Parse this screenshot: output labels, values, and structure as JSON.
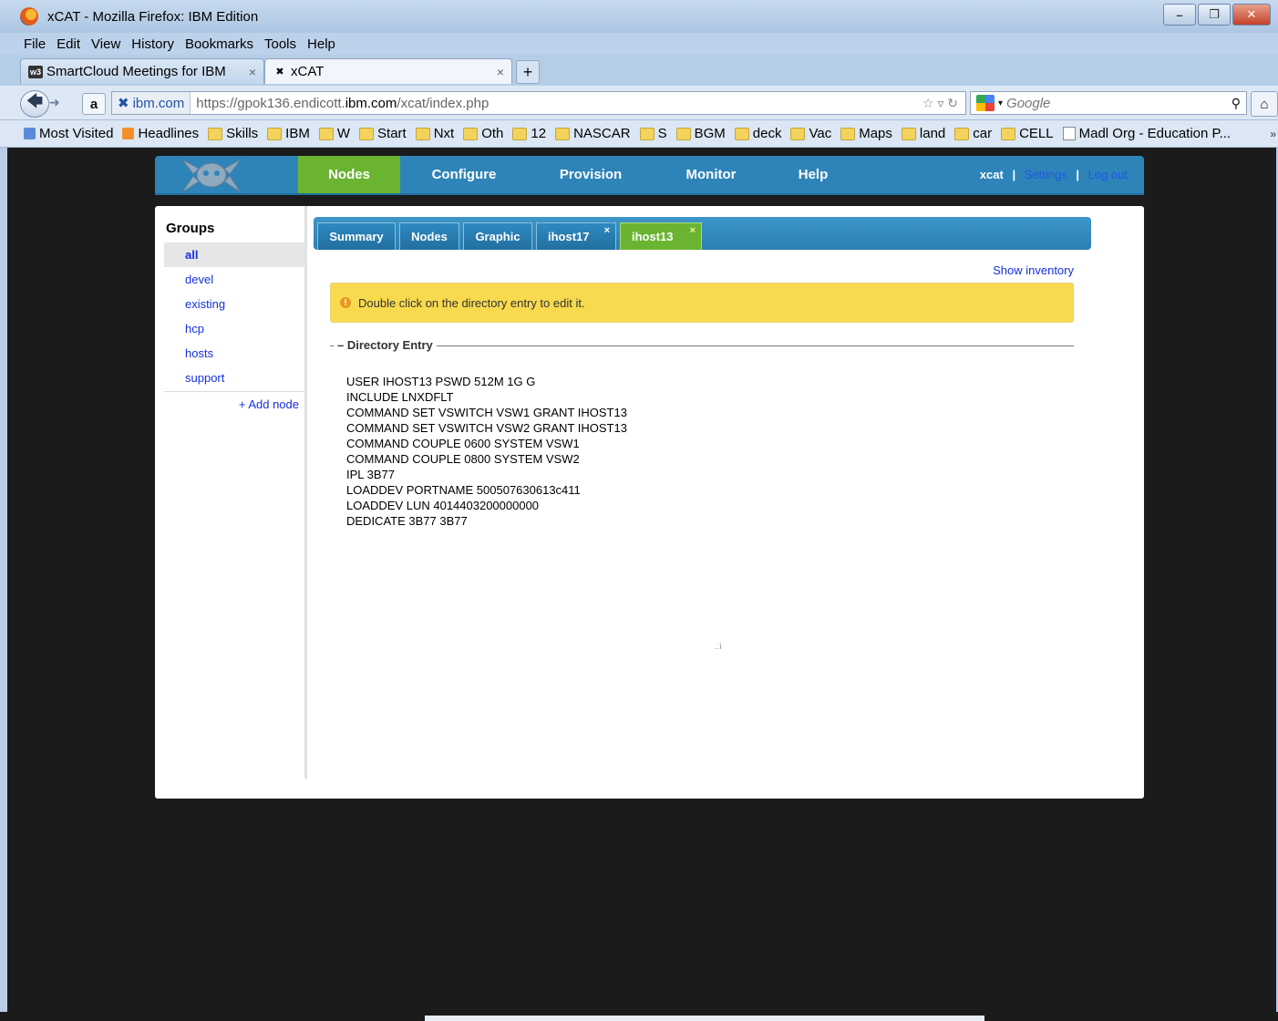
{
  "window": {
    "title": "xCAT - Mozilla Firefox: IBM Edition",
    "buttons": {
      "minimize": "–",
      "restore": "❐",
      "close": "✕"
    }
  },
  "menu": [
    "File",
    "Edit",
    "View",
    "History",
    "Bookmarks",
    "Tools",
    "Help"
  ],
  "browser_tabs": [
    {
      "label": "SmartCloud Meetings for IBM",
      "favicon": "w3"
    },
    {
      "label": "xCAT",
      "favicon": "xcat-icon"
    }
  ],
  "new_tab_label": "+",
  "navigation": {
    "site": "ibm.com",
    "url_prefix": "https://gpok136.endicott.",
    "url_domain": "ibm.com",
    "url_suffix": "/xcat/index.php",
    "search_placeholder": "Google"
  },
  "bookmarks": [
    {
      "label": "Most Visited",
      "icon": "most-visited"
    },
    {
      "label": "Headlines",
      "icon": "rss"
    },
    {
      "label": "Skills",
      "icon": "folder"
    },
    {
      "label": "IBM",
      "icon": "folder"
    },
    {
      "label": "W",
      "icon": "folder"
    },
    {
      "label": "Start",
      "icon": "folder"
    },
    {
      "label": "Nxt",
      "icon": "folder"
    },
    {
      "label": "Oth",
      "icon": "folder"
    },
    {
      "label": "12",
      "icon": "folder"
    },
    {
      "label": "NASCAR",
      "icon": "folder"
    },
    {
      "label": "S",
      "icon": "folder"
    },
    {
      "label": "BGM",
      "icon": "folder"
    },
    {
      "label": "deck",
      "icon": "folder"
    },
    {
      "label": "Vac",
      "icon": "folder"
    },
    {
      "label": "Maps",
      "icon": "folder"
    },
    {
      "label": "land",
      "icon": "folder"
    },
    {
      "label": "car",
      "icon": "folder"
    },
    {
      "label": "CELL",
      "icon": "folder"
    },
    {
      "label": "Madl Org - Education P...",
      "icon": "page"
    }
  ],
  "xcat": {
    "nav": [
      "Nodes",
      "Configure",
      "Provision",
      "Monitor",
      "Help"
    ],
    "active_nav": "Nodes",
    "user": "xcat",
    "settings_label": "Settings",
    "logout_label": "Log out",
    "separator": "|",
    "groups_title": "Groups",
    "groups": [
      "all",
      "devel",
      "existing",
      "hcp",
      "hosts",
      "support"
    ],
    "selected_group": "all",
    "add_node_label": "+ Add node",
    "tabs": [
      {
        "label": "Summary",
        "closable": false
      },
      {
        "label": "Nodes",
        "closable": false
      },
      {
        "label": "Graphic",
        "closable": false
      },
      {
        "label": "ihost17",
        "closable": true
      },
      {
        "label": "ihost13",
        "closable": true
      }
    ],
    "tab_close_glyph": "×",
    "show_inventory_label": "Show inventory",
    "info_message": "Double click on the directory entry to edit it.",
    "directory_legend": "– Directory Entry",
    "directory_lines": [
      "USER IHOST13 PSWD 512M 1G G",
      "INCLUDE LNXDFLT",
      "COMMAND SET VSWITCH VSW1 GRANT IHOST13",
      "COMMAND SET VSWITCH VSW2 GRANT IHOST13",
      "COMMAND COUPLE 0600 SYSTEM VSW1",
      "COMMAND COUPLE 0800 SYSTEM VSW2",
      "IPL 3B77",
      "LOADDEV PORTNAME 500507630613c411",
      "LOADDEV LUN 4014403200000000",
      "DEDICATE 3B77 3B77"
    ],
    "colors": {
      "header_blue": "#2e84b8",
      "active_green": "#6ab431",
      "info_yellow": "#f8da4e",
      "link_blue": "#1530e0"
    }
  }
}
